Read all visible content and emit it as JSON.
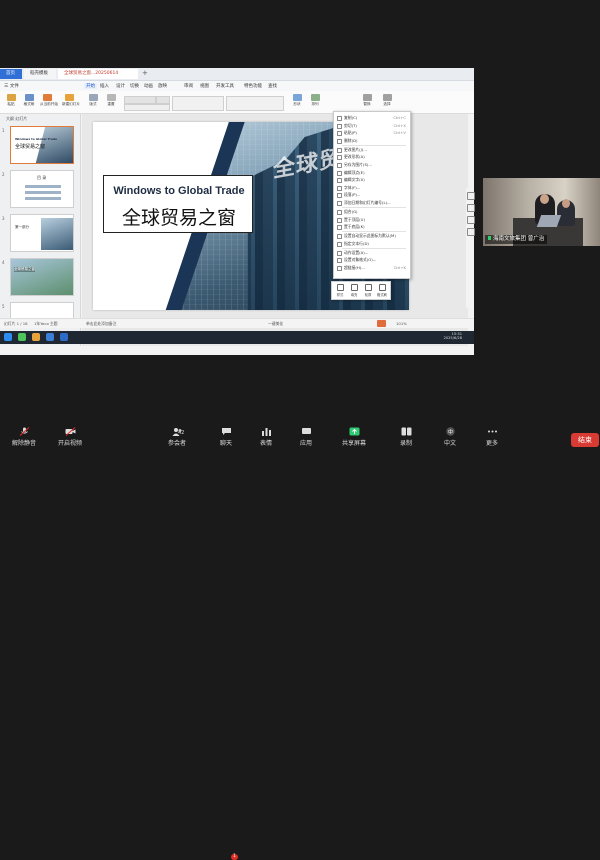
{
  "wps": {
    "tabs": [
      "首页",
      "稻壳模板",
      "全球贸易之窗...20250614"
    ],
    "menu": [
      "三 文件",
      "开始",
      "插入",
      "设计",
      "切换",
      "动画",
      "放映",
      "审阅",
      "视图",
      "开发工具",
      "特色功能",
      "查找"
    ],
    "ribbon_labels": [
      "粘贴",
      "格式刷",
      "从当前开始",
      "新建幻灯片",
      "版式",
      "重置",
      "字体",
      "形状",
      "排列",
      "替换",
      "选择"
    ]
  },
  "thumbs": {
    "tabs": "大纲  幻灯片",
    "numbers": [
      "1",
      "2",
      "3",
      "4",
      "5"
    ],
    "t1_en": "Windows to Global Trade",
    "t1_cn": "全球贸易之窗",
    "t2": "目 录",
    "t3": "第一部分",
    "t4": "全球贸易之窗"
  },
  "slide": {
    "title_en": "Windows to Global Trade",
    "title_cn": "全球贸易之窗",
    "building_text": "全球贸易之"
  },
  "context_menu": [
    {
      "label": "复制(C)",
      "shortcut": "Ctrl+C"
    },
    {
      "label": "剪切(T)",
      "shortcut": "Ctrl+X"
    },
    {
      "label": "粘贴(P)",
      "shortcut": "Ctrl+V"
    },
    {
      "label": "删除(D)",
      "shortcut": ""
    },
    {
      "label": "更改图片(J)...",
      "shortcut": ""
    },
    {
      "label": "更改形状(A)",
      "shortcut": ""
    },
    {
      "label": "另存为图片(S)...",
      "shortcut": ""
    },
    {
      "label": "编辑顶点(E)",
      "shortcut": ""
    },
    {
      "label": "编辑文字(X)",
      "shortcut": ""
    },
    {
      "label": "字体(F)...",
      "shortcut": ""
    },
    {
      "label": "段落(P)...",
      "shortcut": ""
    },
    {
      "label": "添加日期和幻灯片编号(L)...",
      "shortcut": ""
    },
    {
      "label": "组合(G)",
      "shortcut": ""
    },
    {
      "label": "置于顶层(U)",
      "shortcut": ""
    },
    {
      "label": "置于底层(K)",
      "shortcut": ""
    },
    {
      "label": "设置自动显示此图标为默认(M)",
      "shortcut": ""
    },
    {
      "label": "指定文本行(D)",
      "shortcut": ""
    },
    {
      "label": "动作设置(A)...",
      "shortcut": ""
    },
    {
      "label": "设置对象格式(O)...",
      "shortcut": ""
    },
    {
      "label": "超链接(H)...",
      "shortcut": "Ctrl+K"
    }
  ],
  "mini_toolbar": [
    "样式",
    "填充",
    "轮廓",
    "格式刷"
  ],
  "statusbar": {
    "slide": "幻灯片 1 / 18",
    "theme": "1年Yoco 主题",
    "notes": "单击此处添加备注",
    "more": "一键美化",
    "zoom": "101%"
  },
  "taskbar": {
    "time": "15:31",
    "date": "2025/6/28"
  },
  "participant": {
    "name": "海南文旅集团 曾广治"
  },
  "zoom_controls": {
    "mute": "解除静音",
    "video": "开启视频",
    "participants": "参会者",
    "participant_count": "42",
    "chat": "聊天",
    "chat_badge": "1",
    "reactions": "表情",
    "share": "共享屏幕",
    "record": "录制",
    "apps": "应用",
    "language": "中文",
    "more": "更多",
    "end": "结束"
  },
  "colors": {
    "accent_blue": "#2f6fd6",
    "end_red": "#d83a34",
    "share_green": "#2ecc71",
    "slide_navy": "#1a3555"
  }
}
